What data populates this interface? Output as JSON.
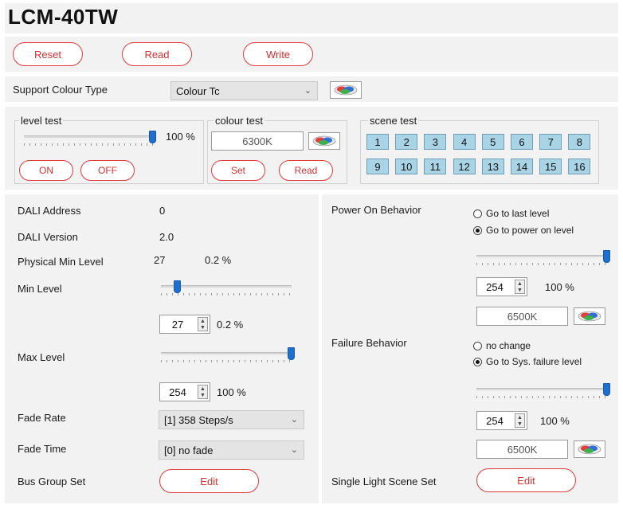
{
  "app_title": "LCM-40TW",
  "toolbar": {
    "reset": "Reset",
    "read": "Read",
    "write": "Write"
  },
  "support": {
    "label": "Support Colour Type",
    "selected": "Colour Tc"
  },
  "level_test": {
    "title": "level test",
    "percent": "100 %",
    "level_fraction": 1.0,
    "on": "ON",
    "off": "OFF"
  },
  "colour_test": {
    "title": "colour test",
    "value": "6300K",
    "set": "Set",
    "read": "Read"
  },
  "scene_test": {
    "title": "scene test",
    "buttons": [
      "1",
      "2",
      "3",
      "4",
      "5",
      "6",
      "7",
      "8",
      "9",
      "10",
      "11",
      "12",
      "13",
      "14",
      "15",
      "16"
    ]
  },
  "left": {
    "dali_address_label": "DALI Address",
    "dali_address": "0",
    "dali_version_label": "DALI Version",
    "dali_version": "2.0",
    "phys_min_label": "Physical Min Level",
    "phys_min": "27",
    "phys_min_pct": "0.2 %",
    "min_level_label": "Min Level",
    "min_level": "27",
    "min_level_pct": "0.2 %",
    "min_level_fraction": 0.1,
    "max_level_label": "Max Level",
    "max_level": "254",
    "max_level_pct": "100 %",
    "max_level_fraction": 1.0,
    "fade_rate_label": "Fade Rate",
    "fade_rate": "[1] 358 Steps/s",
    "fade_time_label": "Fade Time",
    "fade_time": "[0] no fade",
    "bus_group_label": "Bus Group Set",
    "bus_group_btn": "Edit"
  },
  "right": {
    "power_on_label": "Power On Behavior",
    "power_on_options": [
      "Go to last level",
      "Go to power on level"
    ],
    "power_on_selected": 1,
    "power_on_level": "254",
    "power_on_pct": "100 %",
    "power_on_fraction": 1.0,
    "power_on_colour": "6500K",
    "failure_label": "Failure Behavior",
    "failure_options": [
      "no change",
      "Go to Sys. failure level"
    ],
    "failure_selected": 1,
    "failure_level": "254",
    "failure_pct": "100 %",
    "failure_fraction": 1.0,
    "failure_colour": "6500K",
    "scene_set_label": "Single Light Scene Set",
    "scene_set_btn": "Edit"
  },
  "colors": {
    "accent_red": "#e03a3a",
    "slider_blue": "#1f6fd1",
    "scene_blue": "#a9d4e6"
  }
}
